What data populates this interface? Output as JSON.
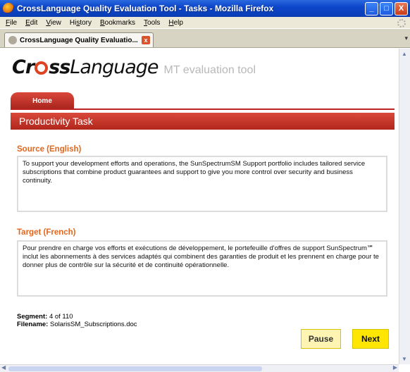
{
  "window": {
    "title": "CrossLanguage Quality Evaluation Tool - Tasks - Mozilla Firefox",
    "controls": {
      "minimize": "_",
      "maximize": "□",
      "close": "X"
    }
  },
  "menu": {
    "items": [
      {
        "u": "F",
        "rest": "ile"
      },
      {
        "u": "E",
        "rest": "dit"
      },
      {
        "u": "V",
        "rest": "iew"
      },
      {
        "pre": "Hi",
        "u": "s",
        "rest": "tory"
      },
      {
        "u": "B",
        "rest": "ookmarks"
      },
      {
        "u": "T",
        "rest": "ools"
      },
      {
        "u": "H",
        "rest": "elp"
      }
    ]
  },
  "browser_tab": {
    "label": "CrossLanguage Quality Evaluatio...",
    "close": "x"
  },
  "logo": {
    "cross_pre": "Cr",
    "cross_post": "ss",
    "language": "Language",
    "tagline": "MT evaluation tool"
  },
  "nav": {
    "home": "Home"
  },
  "task": {
    "title": "Productivity Task",
    "source_label": "Source (English)",
    "source_text": "To support your development efforts and operations, the SunSpectrumSM Support portfolio includes tailored service subscriptions that combine product guarantees and support to give you more control over security and business continuity.",
    "target_label": "Target (French)",
    "target_text": "Pour prendre en charge vos efforts et exécutions de développement, le portefeuille d'offres de support SunSpectrum℠ inclut les abonnements à des services adaptés qui combinent des garanties de produit et les prennent en charge pour te donner plus de contrôle sur la sécurité et de continuité opérationnelle.",
    "segment_label": "Segment:",
    "segment_value": "4 of 110",
    "filename_label": "Filename:",
    "filename_value": "SolarisSM_Subscriptions.doc",
    "pause_label": "Pause",
    "next_label": "Next"
  },
  "colors": {
    "accent_red": "#b1261c",
    "section_orange": "#e3661c",
    "next_yellow": "#ffe600",
    "pause_yellow": "#fff4b2",
    "titlebar_blue": "#0d46c9"
  }
}
